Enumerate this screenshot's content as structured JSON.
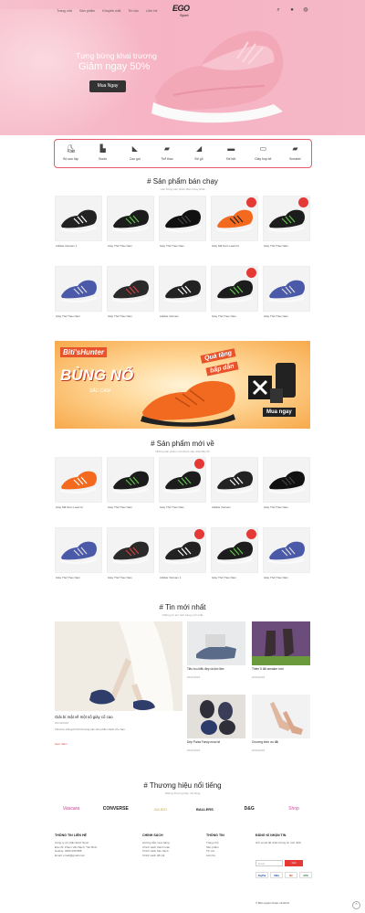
{
  "header": {
    "nav": [
      "Trang chủ",
      "Sản phẩm",
      "Khuyến mãi",
      "Tin tức",
      "Liên hệ"
    ],
    "logo": {
      "mark": "EGO",
      "sub": "Sport"
    },
    "icons": [
      "search-icon",
      "user-icon",
      "cart-icon"
    ]
  },
  "hero": {
    "line1": "Tưng bừng khai trương",
    "line2": "Giảm ngay 50%",
    "button": "Mua Ngay"
  },
  "categories": [
    {
      "label": "Bộ sưu tập",
      "icon": "ice-skate-icon"
    },
    {
      "label": "Boots",
      "icon": "boot-icon"
    },
    {
      "label": "Cao gót",
      "icon": "high-heel-icon"
    },
    {
      "label": "Thể thao",
      "icon": "sneaker-icon"
    },
    {
      "label": "Đế gỗ",
      "icon": "clog-icon"
    },
    {
      "label": "Đế bệt",
      "icon": "flat-shoe-icon"
    },
    {
      "label": "Giày búp bê",
      "icon": "loafer-icon"
    },
    {
      "label": "Sneaker",
      "icon": "running-shoe-icon"
    }
  ],
  "bestsellers": {
    "title": "# Sản phẩm bán chạy",
    "subtitle": "Các thông sản phẩm Bán Chạy Nhất",
    "products": [
      {
        "name": "Adidas Vietnam 1",
        "price": "",
        "old": "",
        "color": "#222",
        "accent": "#fff",
        "sale": false
      },
      {
        "name": "Giày Thể Thao Nam",
        "price": "",
        "old": "",
        "color": "#1c1c1c",
        "accent": "#5fc24a",
        "sale": false
      },
      {
        "name": "Giày Thể Thao Nam",
        "price": "",
        "old": "",
        "color": "#111",
        "accent": "#444",
        "sale": false
      },
      {
        "name": "Giày Mã Nam Lead Gt",
        "price": "",
        "old": "",
        "color": "#f36a1f",
        "accent": "#222",
        "sale": true
      },
      {
        "name": "Giày Thể Thao Nam",
        "price": "",
        "old": "",
        "color": "#1c1c1c",
        "accent": "#5fc24a",
        "sale": true
      },
      {
        "name": "Giày Thể Thao Nam",
        "price": "",
        "old": "",
        "color": "#4b5aa8",
        "accent": "#ddd",
        "sale": false
      },
      {
        "name": "Giày Thể Thao Nam",
        "price": "",
        "old": "",
        "color": "#2a2a2a",
        "accent": "#d04040",
        "sale": false
      },
      {
        "name": "Adidas Vietnam",
        "price": "",
        "old": "",
        "color": "#222",
        "accent": "#fff",
        "sale": false
      },
      {
        "name": "Giày Thể Thao Nam",
        "price": "",
        "old": "",
        "color": "#1c1c1c",
        "accent": "#5fc24a",
        "sale": true
      },
      {
        "name": "Giày Thể Thao Nam",
        "price": "",
        "old": "",
        "color": "#4b5aa8",
        "accent": "#ddd",
        "sale": false
      }
    ]
  },
  "banner": {
    "brand": "Biti'sHunter",
    "big": "BÙNG NỔ",
    "small": "SẮC CAM",
    "gift1": "Quà tặng",
    "gift2": "bấp dẫn",
    "button": "Mua ngay"
  },
  "newproducts": {
    "title": "# Sản phẩm mới về",
    "subtitle": "Những sản phẩm mới được cập nhật đầy đủ",
    "products": [
      {
        "name": "Giày Mã Nam Lead Gt",
        "price": "",
        "old": "",
        "color": "#f36a1f",
        "accent": "#fff",
        "sale": false
      },
      {
        "name": "Giày Thể Thao Nam",
        "price": "",
        "old": "",
        "color": "#1c1c1c",
        "accent": "#5fc24a",
        "sale": false
      },
      {
        "name": "Giày Thể Thao Nam",
        "price": "",
        "old": "",
        "color": "#1c1c1c",
        "accent": "#5fc24a",
        "sale": true
      },
      {
        "name": "Adidas Vietnam",
        "price": "",
        "old": "",
        "color": "#222",
        "accent": "#fff",
        "sale": false
      },
      {
        "name": "Giày Thể Thao Nam",
        "price": "",
        "old": "",
        "color": "#111",
        "accent": "#444",
        "sale": false
      },
      {
        "name": "Giày Thể Thao Nam",
        "price": "",
        "old": "",
        "color": "#4b5aa8",
        "accent": "#ddd",
        "sale": false
      },
      {
        "name": "Giày Thể Thao Nam",
        "price": "",
        "old": "",
        "color": "#2a2a2a",
        "accent": "#d04040",
        "sale": false
      },
      {
        "name": "Adidas Vietnam 1",
        "price": "",
        "old": "",
        "color": "#222",
        "accent": "#fff",
        "sale": true
      },
      {
        "name": "Giày Thể Thao Nam",
        "price": "",
        "old": "",
        "color": "#1c1c1c",
        "accent": "#5fc24a",
        "sale": true
      },
      {
        "name": "Giày Thể Thao Nam",
        "price": "",
        "old": "",
        "color": "#4b5aa8",
        "accent": "#ddd",
        "sale": false
      }
    ]
  },
  "news": {
    "title": "# Tin mới nhất",
    "subtitle": "Những tin tức thời trang mới nhất",
    "main": {
      "title": "Giải bí mật về một số giày cổ cao",
      "date": "20/10/2018",
      "desc": "Tiêu lưu của giờ thời thượng các sản phẩm dành cho bạn.",
      "more": "Xem thêm"
    },
    "items": [
      {
        "title": "Tiêu lưu kiểu đẹp và lịch lãm",
        "date": "20/10/2018",
        "kind": "bag"
      },
      {
        "title": "Thêm 5 đôi sneaker mới",
        "date": "20/10/2018",
        "kind": "boots"
      },
      {
        "title": "Dép Punta Fancy mùa hè",
        "date": "20/10/2018",
        "kind": "sandals"
      },
      {
        "title": "Chương trình ưu đãi",
        "date": "20/10/2018",
        "kind": "heels"
      }
    ]
  },
  "brands": {
    "title": "# Thương hiệu nổi tiếng",
    "subtitle": "Những thương hiệu nổi tiếng",
    "logos": [
      {
        "name": "Vascara",
        "color": "#c03a8a"
      },
      {
        "name": "CONVERSE",
        "color": "#222"
      },
      {
        "name": "JULIDO",
        "color": "#c8a043"
      },
      {
        "name": "BALLERS",
        "color": "#222"
      },
      {
        "name": "D&G",
        "color": "#222"
      },
      {
        "name": "Shop",
        "color": "#d04fa0"
      }
    ]
  },
  "footer": {
    "contact_title": "THÔNG TIN LIÊN HỆ",
    "contact_lines": [
      "Công ty cổ phần EGO Sport",
      "Địa chỉ: Phạm Văn Bạch, Tân Bình",
      "Hotline: 0966 668 888",
      "Email: email@gmail.com"
    ],
    "policy_title": "CHÍNH SÁCH",
    "policy_lines": [
      "Hướng dẫn mua hàng",
      "Chính sách thanh toán",
      "Chính sách bảo hành",
      "Chính sách đổi trả"
    ],
    "info_title": "THÔNG TIN",
    "info_lines": [
      "Trang chủ",
      "Sản phẩm",
      "Tin tức",
      "Liên hệ"
    ],
    "sub_title": "ĐĂNG KÍ NHẬN TIN",
    "sub_text": "Gửi email để nhận thông tin mới nhất",
    "sub_placeholder": "Email",
    "sub_button": "Gửi",
    "payments": [
      "PayPal",
      "VISA",
      "MC",
      "ATM"
    ],
    "copyright": "© Bản quyền thuộc về EGO"
  }
}
